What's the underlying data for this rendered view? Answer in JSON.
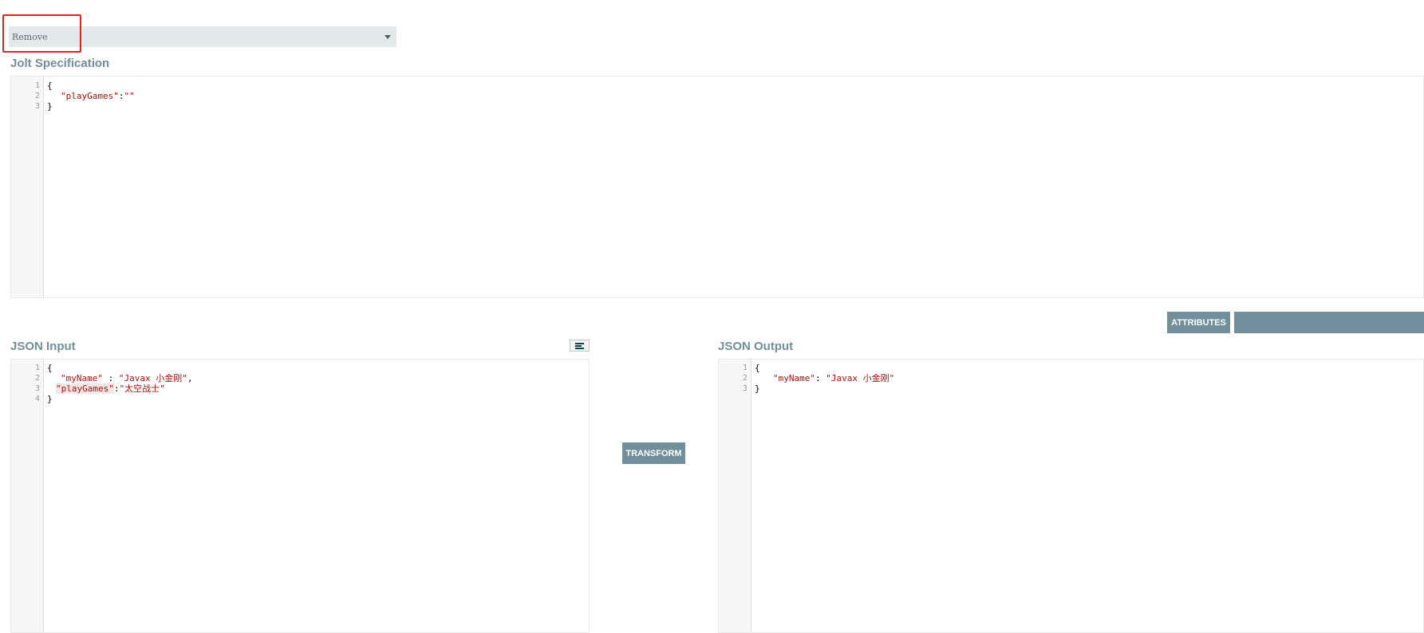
{
  "transform_select": {
    "value": "Remove"
  },
  "jolt_spec": {
    "title": "Jolt Specification",
    "lines": [
      {
        "num": "1",
        "text": "{"
      },
      {
        "num": "2",
        "key": "\"playGames\"",
        "sep": ":",
        "val": "\"\""
      },
      {
        "num": "3",
        "text": "}"
      }
    ]
  },
  "toolbar": {
    "attributes_label": "ATTRIBUTES"
  },
  "json_input": {
    "title": "JSON Input",
    "format_icon": "align-left-icon",
    "lines": [
      {
        "num": "1",
        "text": "{"
      },
      {
        "num": "2",
        "key": "\"myName\"",
        "sep": " : ",
        "val": "\"Javax 小金刚\"",
        "tail": ","
      },
      {
        "num": "3",
        "key": "\"playGames\"",
        "sep": ":",
        "val": "\"太空战士\""
      },
      {
        "num": "4",
        "text": "}"
      }
    ]
  },
  "transform_button": {
    "label": "TRANSFORM"
  },
  "json_output": {
    "title": "JSON Output",
    "lines": [
      {
        "num": "1",
        "text": "{"
      },
      {
        "num": "2",
        "key": "\"myName\"",
        "sep": ": ",
        "val": "\"Javax 小金刚\""
      },
      {
        "num": "3",
        "text": "}"
      }
    ]
  },
  "colors": {
    "accent": "#728e9b",
    "string": "#aa1111",
    "highlight_border": "#e6231b"
  }
}
